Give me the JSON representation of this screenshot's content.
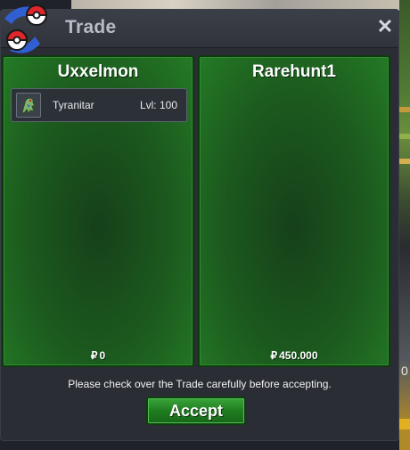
{
  "window": {
    "title": "Trade",
    "close_icon_glyph": "✕"
  },
  "left_panel": {
    "player_name": "Uxxelmon",
    "items": [
      {
        "icon": "tyranitar-sprite-icon",
        "name": "Tyranitar",
        "level": "Lvl: 100"
      }
    ],
    "money": "0"
  },
  "right_panel": {
    "player_name": "Rarehunt1",
    "items": [],
    "money": "450.000"
  },
  "currency_symbol": "₽",
  "notice": "Please check over the Trade carefully before accepting.",
  "accept_button": "Accept",
  "edge_glyph": "0",
  "colors": {
    "panel_green": "#1c5a1e",
    "button_green": "#1f7d1f",
    "window_bg": "#2a2d34",
    "title_text": "#b7bbc4"
  }
}
